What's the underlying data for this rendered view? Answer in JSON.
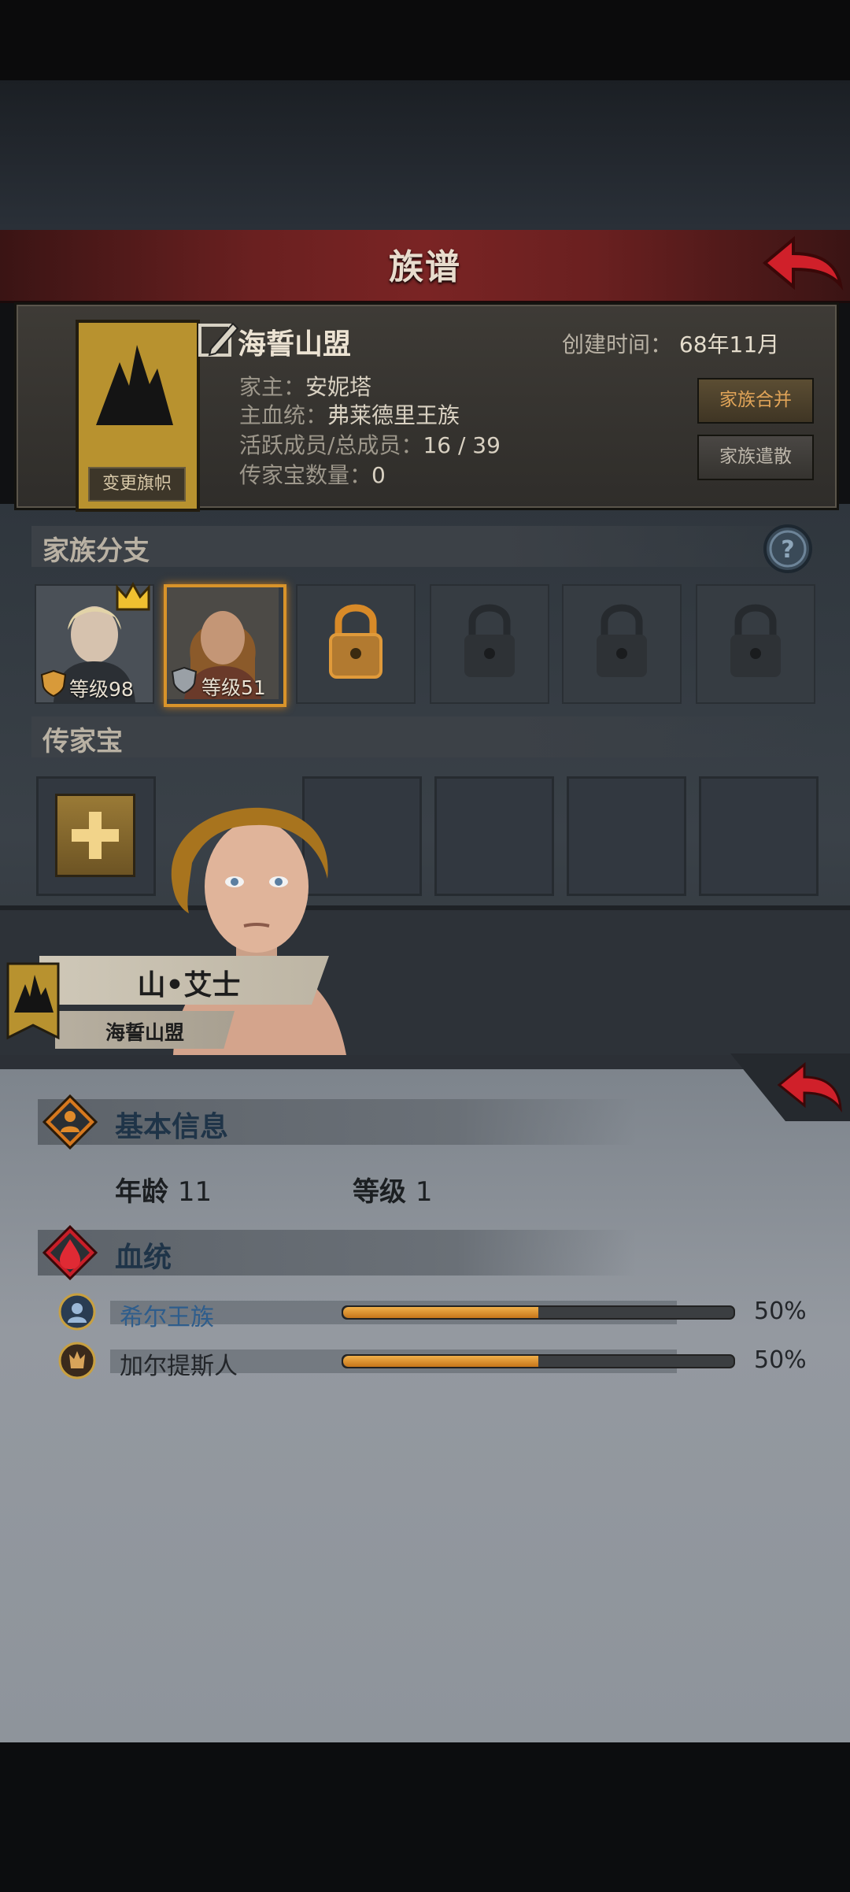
{
  "header": {
    "title": "族谱"
  },
  "family": {
    "banner_label": "变更旗帜",
    "name": "海誓山盟",
    "created_label": "创建时间：",
    "created_value": "68年11月",
    "head_label": "家主：",
    "head_value": "安妮塔",
    "bloodline_label": "主血统：",
    "bloodline_value": "弗莱德里王族",
    "members_label": "活跃成员/总成员：",
    "members_value": "16 / 39",
    "heirloom_count_label": "传家宝数量：",
    "heirloom_count_value": "0",
    "merge_button": "家族合并",
    "dissolve_button": "家族遣散",
    "banner_color": "#b8922f"
  },
  "branches": {
    "title": "家族分支",
    "slots": [
      {
        "level_text": "等级98",
        "leader": true
      },
      {
        "level_text": "等级51",
        "selected": true
      }
    ],
    "locked_slots": 4
  },
  "heirlooms": {
    "title": "传家宝",
    "empty_slots": 5
  },
  "character": {
    "name": "山•艾士",
    "family": "海誓山盟"
  },
  "basic_info": {
    "title": "基本信息",
    "age_label": "年龄",
    "age_value": "11",
    "level_label": "等级",
    "level_value": "1"
  },
  "bloodline": {
    "title": "血统",
    "rows": [
      {
        "name": "希尔王族",
        "percent": 50,
        "percent_text": "50%",
        "color": "#2e5d8c"
      },
      {
        "name": "加尔提斯人",
        "percent": 50,
        "percent_text": "50%",
        "color": "#23262a"
      }
    ]
  },
  "colors": {
    "accent_orange": "#d8932a",
    "title_red": "#7a2424",
    "arrow_red": "#d0202a"
  }
}
